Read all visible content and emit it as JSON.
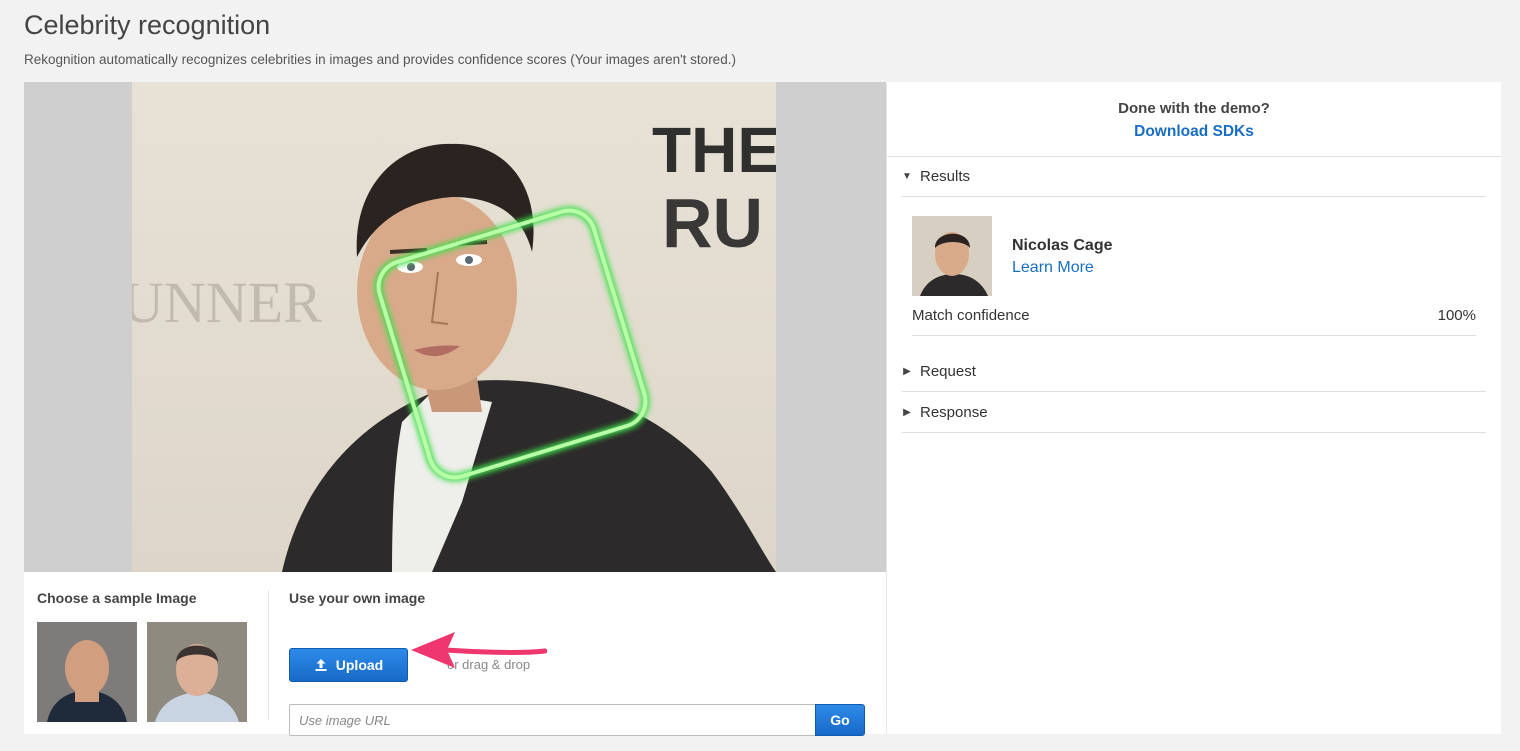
{
  "page": {
    "title": "Celebrity recognition",
    "subtitle": "Rekognition automatically recognizes celebrities in images and provides confidence scores (Your images aren't stored.)"
  },
  "controls": {
    "sample_heading": "Choose a sample Image",
    "own_heading": "Use your own image",
    "upload_label": "Upload",
    "drag_text": "or drag & drop",
    "url_placeholder": "Use image URL",
    "go_label": "Go"
  },
  "right": {
    "demo_question": "Done with the demo?",
    "sdk_link": "Download SDKs",
    "sections": {
      "results": "Results",
      "request": "Request",
      "response": "Response"
    }
  },
  "result": {
    "name": "Nicolas Cage",
    "learn_more": "Learn More",
    "confidence_label": "Match confidence",
    "confidence_value": "100%"
  },
  "colors": {
    "accent": "#1a6ec2",
    "button": "#1f74d4",
    "bounding_box": "#3fe04a",
    "annotation_arrow": "#f0366f"
  },
  "icons": {
    "upload": "upload-icon",
    "expanded": "caret-down-icon",
    "collapsed": "caret-right-icon"
  }
}
